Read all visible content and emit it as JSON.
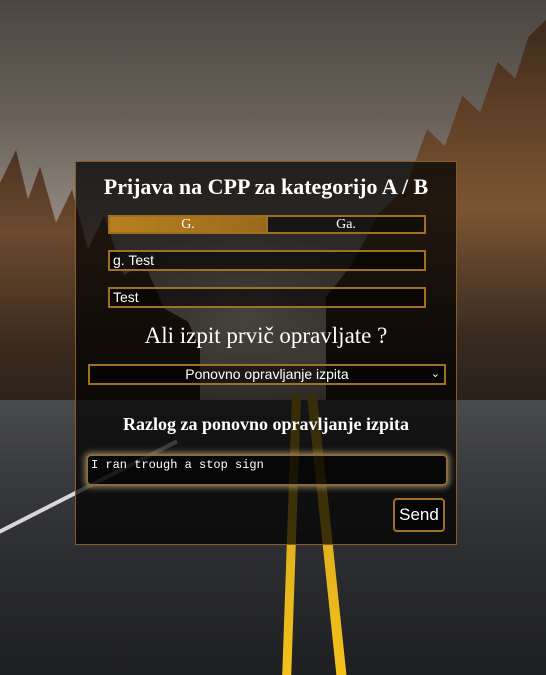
{
  "form": {
    "title": "Prijava na CPP za kategorijo A / B",
    "tabs": [
      {
        "label": "G.",
        "active": true
      },
      {
        "label": "Ga.",
        "active": false
      }
    ],
    "name_value": "g. Test",
    "surname_value": "Test",
    "question": "Ali izpit prvič opravljate ?",
    "exam_select_value": "Ponovno opravljanje izpita",
    "reason_heading": "Razlog za ponovno opravljanje izpita",
    "reason_value": "I ran trough a stop sign",
    "send_label": "Send"
  },
  "colors": {
    "accent_border": "#a07022",
    "active_tab": "#b8801f"
  },
  "icons": {
    "select_arrow": "chevron-down-icon"
  }
}
